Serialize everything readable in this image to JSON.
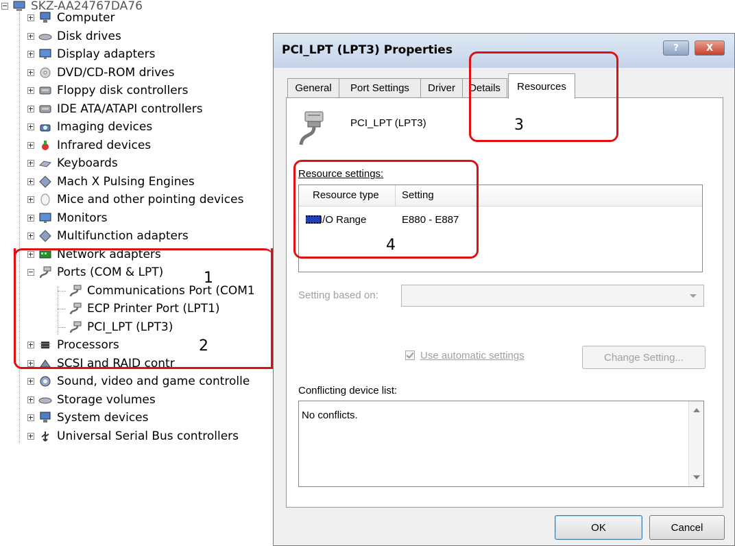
{
  "device_tree": {
    "root_label": "SKZ-AA24767DA76",
    "items": [
      {
        "label": "Computer",
        "icon": "computer-icon",
        "expander": "plus"
      },
      {
        "label": "Disk drives",
        "icon": "disk-drive-icon",
        "expander": "plus"
      },
      {
        "label": "Display adapters",
        "icon": "monitor-icon",
        "expander": "plus"
      },
      {
        "label": "DVD/CD-ROM drives",
        "icon": "dvd-icon",
        "expander": "plus"
      },
      {
        "label": "Floppy disk controllers",
        "icon": "controller-icon",
        "expander": "plus"
      },
      {
        "label": "IDE ATA/ATAPI controllers",
        "icon": "controller-icon",
        "expander": "plus"
      },
      {
        "label": "Imaging devices",
        "icon": "camera-icon",
        "expander": "plus"
      },
      {
        "label": "Infrared devices",
        "icon": "infrared-icon",
        "expander": "plus"
      },
      {
        "label": "Keyboards",
        "icon": "keyboard-icon",
        "expander": "plus"
      },
      {
        "label": "Mach  X Pulsing Engines",
        "icon": "diamond-icon",
        "expander": "plus"
      },
      {
        "label": "Mice and other pointing devices",
        "icon": "mouse-icon",
        "expander": "plus"
      },
      {
        "label": "Monitors",
        "icon": "monitor-icon",
        "expander": "plus"
      },
      {
        "label": "Multifunction adapters",
        "icon": "diamond-icon",
        "expander": "plus"
      },
      {
        "label": "Network adapters",
        "icon": "network-card-icon",
        "expander": "plus"
      },
      {
        "label": "Ports (COM & LPT)",
        "icon": "port-cable-icon",
        "expander": "minus"
      },
      {
        "label": "Communications Port (COM1",
        "icon": "port-cable-icon",
        "expander": "none"
      },
      {
        "label": "ECP Printer Port (LPT1)",
        "icon": "port-cable-icon",
        "expander": "none"
      },
      {
        "label": "PCI_LPT (LPT3)",
        "icon": "port-cable-icon",
        "expander": "none"
      },
      {
        "label": "Processors",
        "icon": "chip-icon",
        "expander": "plus"
      },
      {
        "label": "SCSI and RAID contr",
        "icon": "scsi-icon",
        "expander": "plus"
      },
      {
        "label": "Sound, video and game controlle",
        "icon": "speaker-icon",
        "expander": "plus"
      },
      {
        "label": "Storage volumes",
        "icon": "disk-drive-icon",
        "expander": "plus"
      },
      {
        "label": "System devices",
        "icon": "computer-icon",
        "expander": "plus"
      },
      {
        "label": "Universal Serial Bus controllers",
        "icon": "usb-icon",
        "expander": "plus"
      }
    ]
  },
  "dialog": {
    "title": "PCI_LPT (LPT3) Properties",
    "help_label": "?",
    "close_label": "X",
    "tabs": [
      {
        "label": "General"
      },
      {
        "label": "Port Settings"
      },
      {
        "label": "Driver"
      },
      {
        "label": "Details"
      },
      {
        "label": "Resources"
      }
    ],
    "device_name": "PCI_LPT (LPT3)",
    "resource_settings_label": "Resource settings:",
    "columns": [
      "Resource type",
      "Setting"
    ],
    "resources": [
      {
        "type": "I/O Range",
        "setting": "E880 - E887"
      }
    ],
    "setting_based_on_label": "Setting based on:",
    "setting_based_on_value": "",
    "use_automatic_label": "Use automatic settings",
    "use_automatic_checked": true,
    "change_setting_label": "Change Setting...",
    "conflicting_label": "Conflicting device list:",
    "conflicts_text": "No conflicts.",
    "ok_label": "OK",
    "cancel_label": "Cancel"
  },
  "annotations": {
    "color": "#e01010",
    "labels": [
      "1",
      "2",
      "3",
      "4"
    ]
  }
}
